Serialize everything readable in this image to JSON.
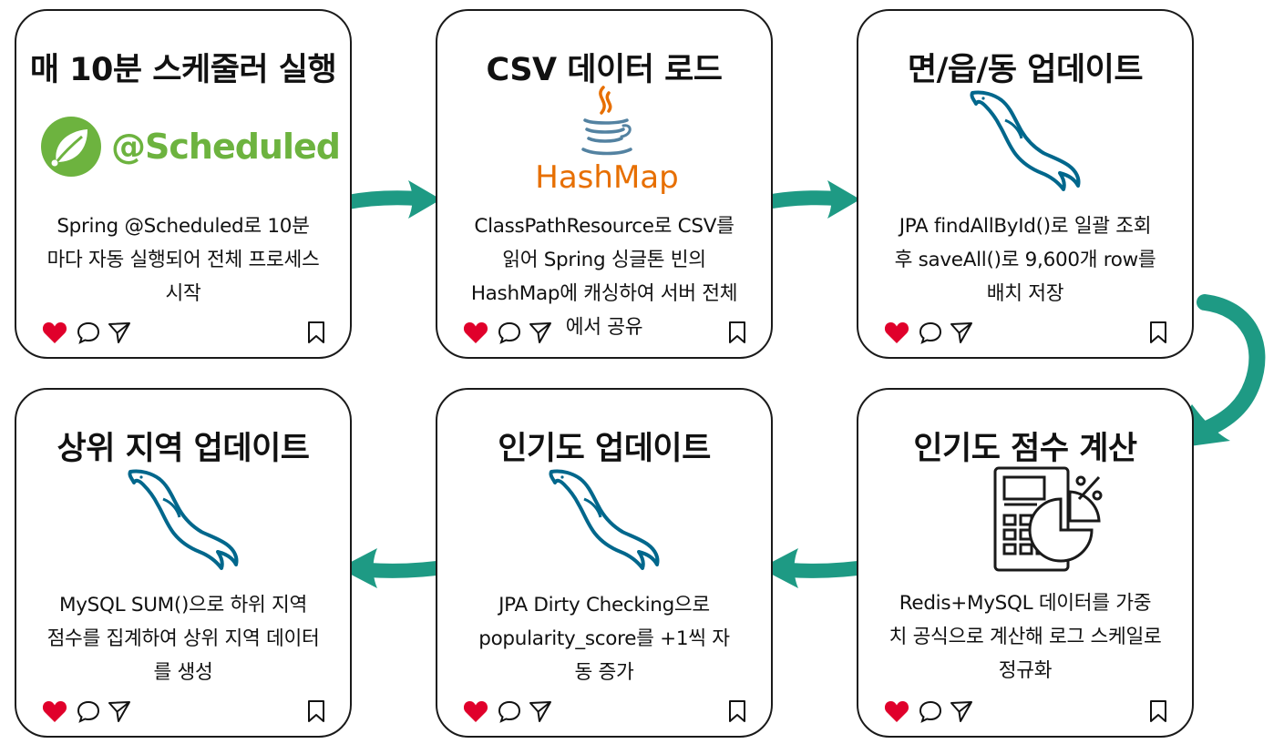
{
  "colors": {
    "accent": "#1e9a84",
    "heart": "#e0002b",
    "spring": "#6db33f",
    "java_red": "#e76f00",
    "java_blue": "#5382a1",
    "mysql": "#00678c"
  },
  "cards": [
    {
      "title": "매 10분 스케줄러 실행",
      "logo": "spring-scheduled",
      "logo_text": "@Scheduled",
      "desc": "Spring @Scheduled로 10분\n마다 자동 실행되어 전체 프로세스\n시작"
    },
    {
      "title": "CSV 데이터 로드",
      "logo": "java-hashmap",
      "logo_text": "HashMap",
      "desc": "ClassPathResource로 CSV를\n읽어 Spring 싱글톤 빈의\nHashMap에 캐싱하여 서버 전체\n에서 공유"
    },
    {
      "title": "면/읍/동 업데이트",
      "logo": "mysql-dolphin",
      "desc": "JPA findAllById()로 일괄 조회\n후 saveAll()로 9,600개 row를\n배치 저장"
    },
    {
      "title": "인기도 점수 계산",
      "logo": "calculator-chart",
      "desc": "Redis+MySQL 데이터를 가중\n치 공식으로 계산해 로그 스케일로\n정규화"
    },
    {
      "title": "인기도 업데이트",
      "logo": "mysql-dolphin",
      "desc": "JPA Dirty Checking으로\npopularity_score를 +1씩 자\n동 증가"
    },
    {
      "title": "상위 지역 업데이트",
      "logo": "mysql-dolphin",
      "desc": "MySQL SUM()으로 하위 지역\n점수를 집계하여 상위 지역 데이터\n를 생성"
    }
  ],
  "icons": {
    "like": "heart-icon",
    "comment": "comment-icon",
    "share": "send-icon",
    "save": "bookmark-icon"
  }
}
